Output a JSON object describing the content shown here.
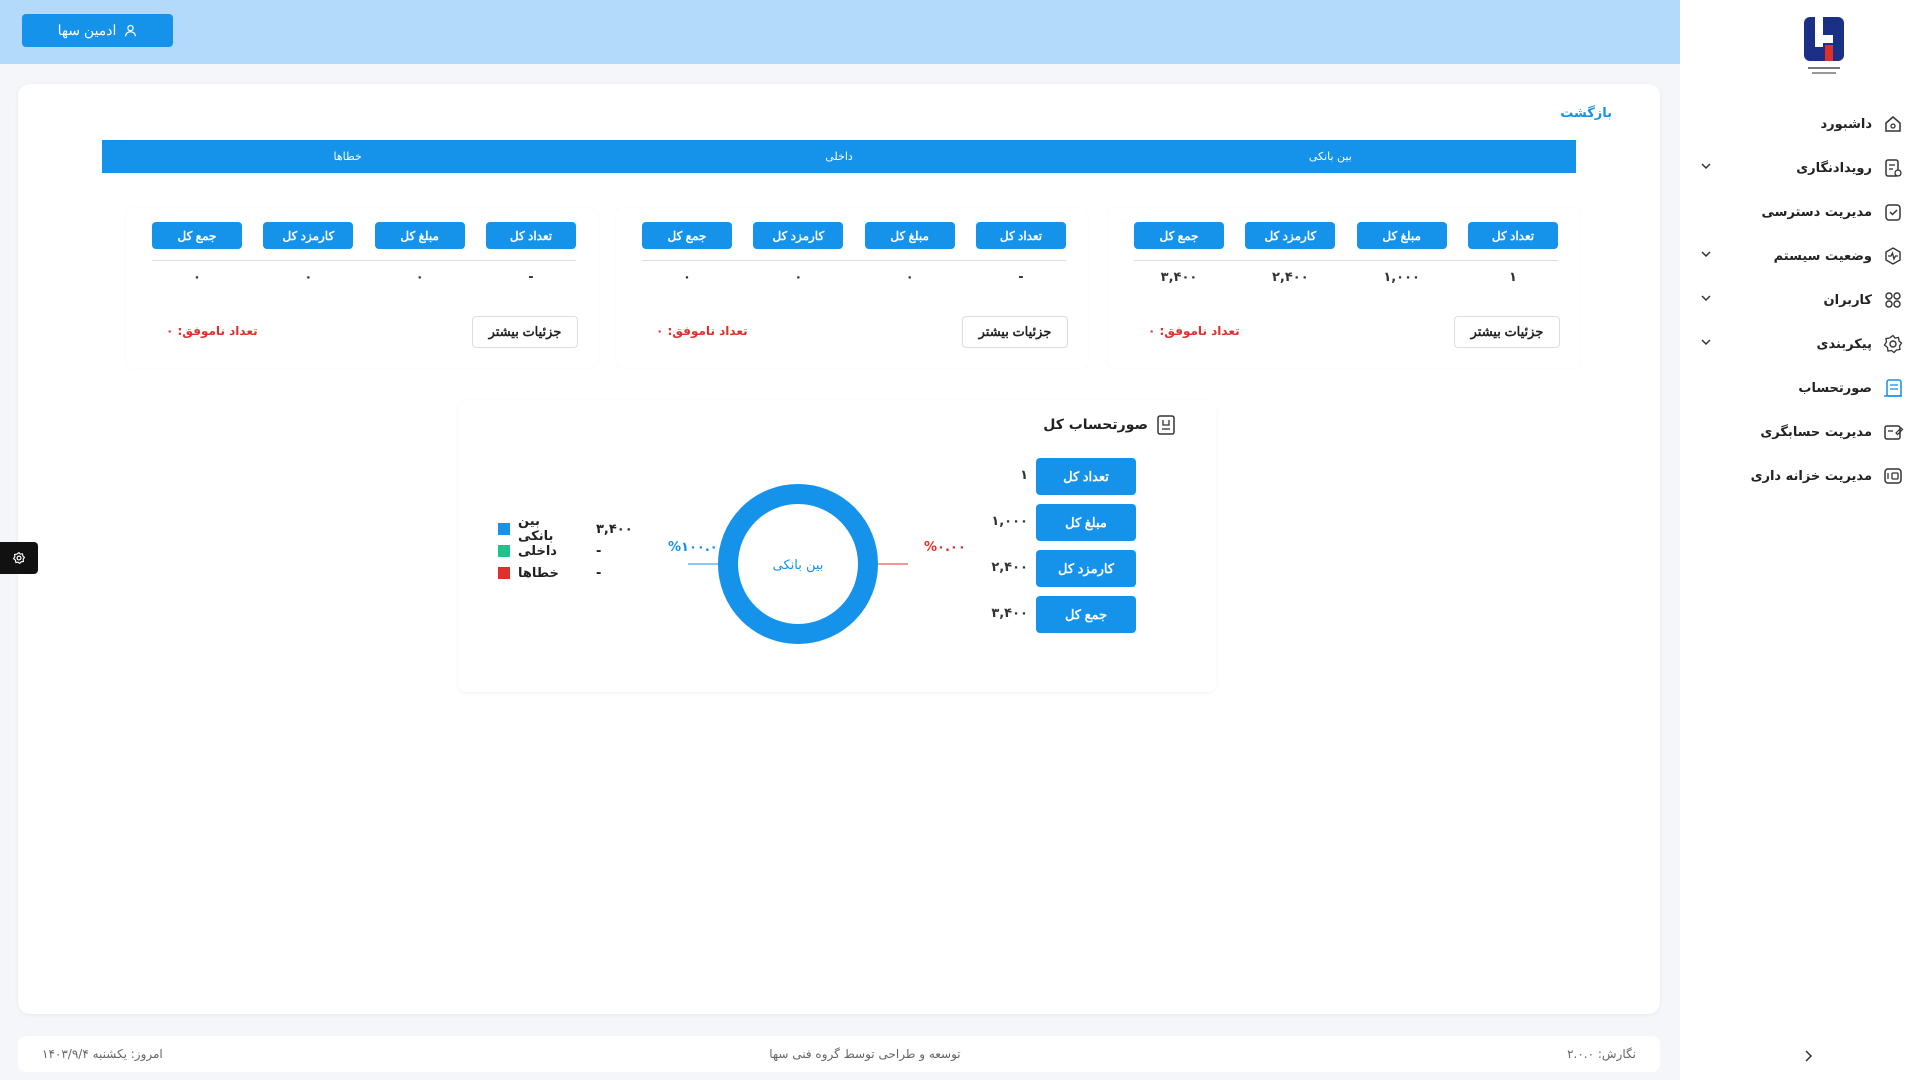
{
  "header": {
    "admin_label": "ادمین سها"
  },
  "sidebar": {
    "items": [
      {
        "label": "داشبورد",
        "icon": "home-icon",
        "expandable": false
      },
      {
        "label": "رویدادنگاری",
        "icon": "log-icon",
        "expandable": true
      },
      {
        "label": "مدیریت دسترسی",
        "icon": "access-check-icon",
        "expandable": false
      },
      {
        "label": "وضعیت سیستم",
        "icon": "pulse-icon",
        "expandable": true
      },
      {
        "label": "کاربران",
        "icon": "users-icon",
        "expandable": true
      },
      {
        "label": "پیکربندی",
        "icon": "gear-icon",
        "expandable": true
      },
      {
        "label": "صورتحساب",
        "icon": "statement-icon",
        "expandable": false,
        "active": true
      },
      {
        "label": "مدیریت حسابگری",
        "icon": "edit-card-icon",
        "expandable": false
      },
      {
        "label": "مدیریت خزانه داری",
        "icon": "treasury-icon",
        "expandable": false
      }
    ]
  },
  "main": {
    "back_label": "بازگشت",
    "tabs": [
      "بین بانکی",
      "داخلی",
      "خطاها"
    ],
    "panels": [
      {
        "headers": [
          "تعداد کل",
          "مبلغ کل",
          "کارمزد کل",
          "جمع کل"
        ],
        "values": [
          "۱",
          "۱,۰۰۰",
          "۲,۴۰۰",
          "۳,۴۰۰"
        ],
        "more_label": "جزئیات بیشتر",
        "failed_label": "تعداد ناموفق: ۰"
      },
      {
        "headers": [
          "تعداد کل",
          "مبلغ کل",
          "کارمزد کل",
          "جمع کل"
        ],
        "values": [
          "-",
          "۰",
          "۰",
          "۰"
        ],
        "more_label": "جزئیات بیشتر",
        "failed_label": "تعداد ناموفق: ۰"
      },
      {
        "headers": [
          "تعداد کل",
          "مبلغ کل",
          "کارمزد کل",
          "جمع کل"
        ],
        "values": [
          "-",
          "۰",
          "۰",
          "۰"
        ],
        "more_label": "جزئیات بیشتر",
        "failed_label": "تعداد ناموفق: ۰"
      }
    ],
    "summary": {
      "title": "صورتحساب کل",
      "rows": [
        {
          "label": "تعداد کل",
          "value": "۱"
        },
        {
          "label": "مبلغ کل",
          "value": "۱,۰۰۰"
        },
        {
          "label": "کارمزد کل",
          "value": "۲,۴۰۰"
        },
        {
          "label": "جمع کل",
          "value": "۳,۴۰۰"
        }
      ],
      "donut_center_label": "بین بانکی",
      "pct_right": "%۰.۰۰",
      "pct_left": "%۱۰۰.۰۰",
      "donut_share": 1.0,
      "legend": [
        {
          "name": "بین بانکی",
          "value": "۳,۴۰۰",
          "color": "#1592ea"
        },
        {
          "name": "داخلی",
          "value": "-",
          "color": "#22c08a"
        },
        {
          "name": "خطاها",
          "value": "-",
          "color": "#e0302c"
        }
      ]
    }
  },
  "footer": {
    "version": "نگارش: ۲.۰.۰",
    "credit": "توسعه و طراحی توسط گروه فنی سها",
    "date": "امروز: یکشنبه ۱۴۰۳/۹/۴"
  },
  "colors": {
    "accent": "#1592ea",
    "topbar": "#b3dafa",
    "danger": "#e0302c"
  }
}
